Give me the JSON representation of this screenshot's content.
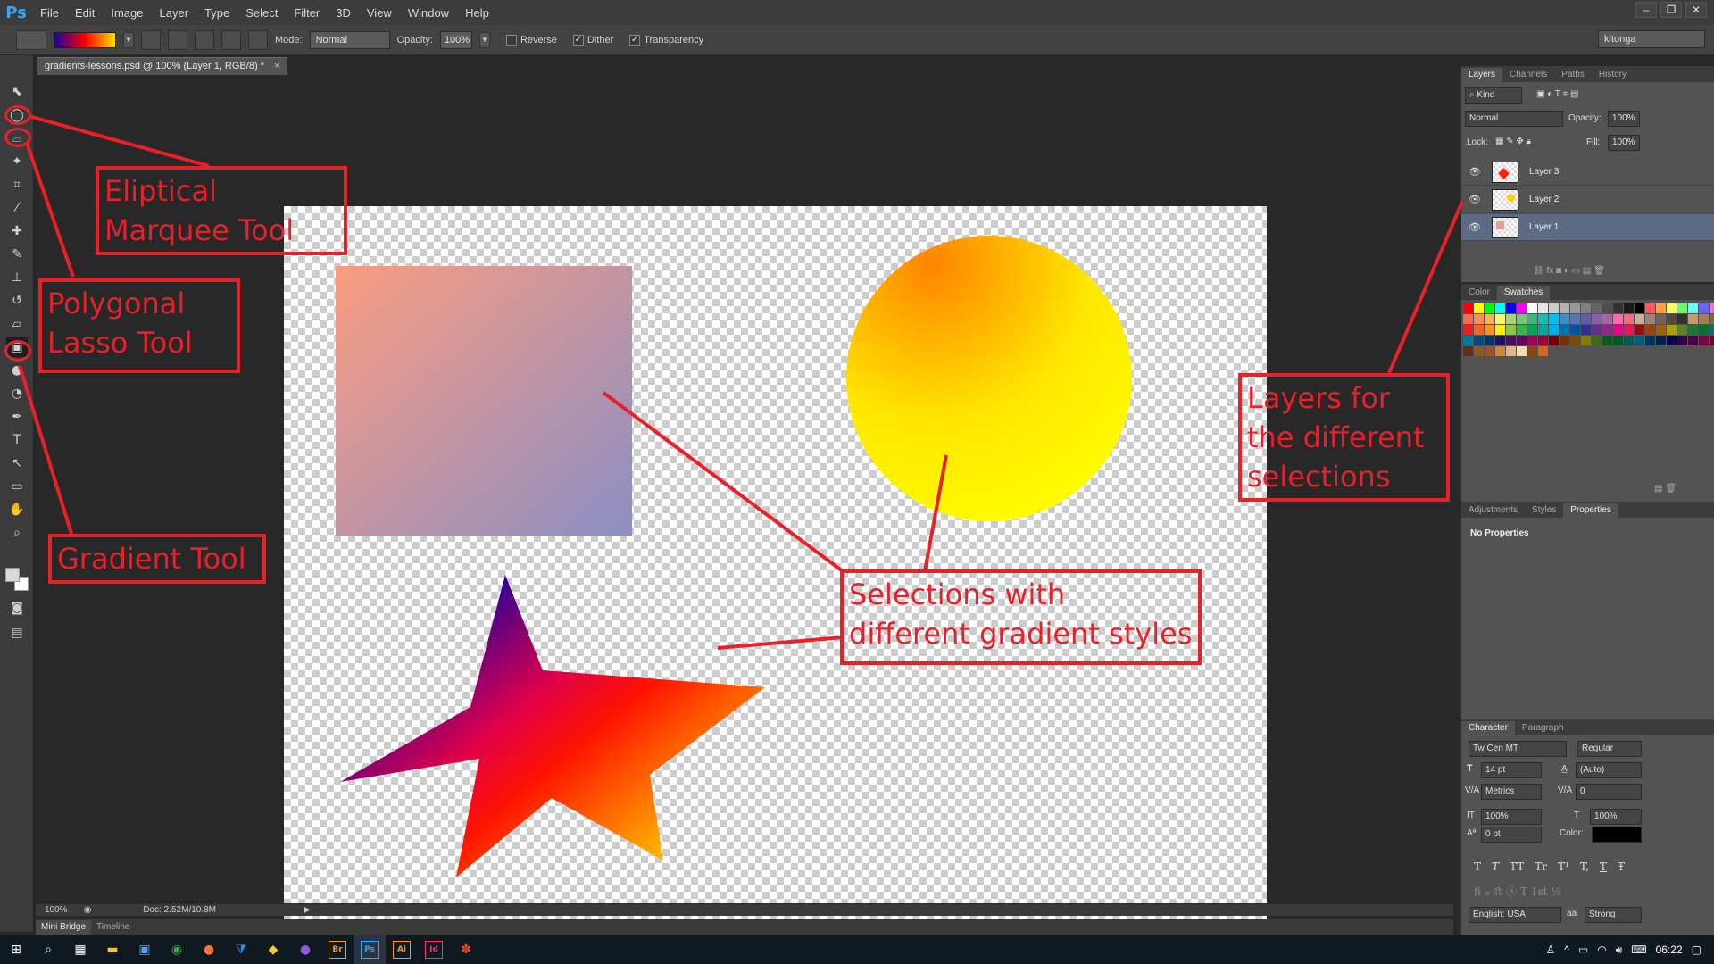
{
  "menubar": {
    "logo": "Ps",
    "items": [
      "File",
      "Edit",
      "Image",
      "Layer",
      "Type",
      "Select",
      "Filter",
      "3D",
      "View",
      "Window",
      "Help"
    ]
  },
  "options": {
    "mode_label": "Mode:",
    "mode_value": "Normal",
    "opacity_label": "Opacity:",
    "opacity_value": "100%",
    "reverse_label": "Reverse",
    "dither_label": "Dither",
    "transparency_label": "Transparency",
    "dither_checked": "✓",
    "transparency_checked": "✓",
    "workspace": "kitonga"
  },
  "document": {
    "tab_title": "gradients-lessons.psd @ 100% (Layer 1, RGB/8) *",
    "close": "×"
  },
  "statusbar": {
    "zoom": "100%",
    "doc": "Doc: 2.52M/10.8M"
  },
  "bottom_tabs": [
    "Mini Bridge",
    "Timeline"
  ],
  "layers_panel": {
    "tabs": [
      "Layers",
      "Channels",
      "Paths",
      "History"
    ],
    "kind": "Kind",
    "blend": "Normal",
    "opacity_label": "Opacity:",
    "opacity_value": "100%",
    "lock_label": "Lock:",
    "fill_label": "Fill:",
    "fill_value": "100%",
    "layers": [
      {
        "name": "Layer 3",
        "selected": false
      },
      {
        "name": "Layer 2",
        "selected": false
      },
      {
        "name": "Layer 1",
        "selected": true
      }
    ]
  },
  "swatches_panel": {
    "tabs": [
      "Color",
      "Swatches"
    ],
    "colors": [
      "#ff0000",
      "#ffff00",
      "#00ff00",
      "#00ffff",
      "#0000ff",
      "#ff00ff",
      "#ffffff",
      "#e6e6e6",
      "#cccccc",
      "#b3b3b3",
      "#999999",
      "#808080",
      "#666666",
      "#4d4d4d",
      "#333333",
      "#1a1a1a",
      "#000000",
      "#ff5a5a",
      "#ffa040",
      "#ffff66",
      "#66ff66",
      "#66ffff",
      "#6666ff",
      "#ff66ff",
      "#f26c4f",
      "#f68e56",
      "#fbaf5c",
      "#fff467",
      "#acd372",
      "#7cc576",
      "#3bb878",
      "#1abbb4",
      "#00bff3",
      "#438ccb",
      "#5574b9",
      "#605ca8",
      "#855fa8",
      "#a763a9",
      "#f06ea9",
      "#f26d7d",
      "#c7b299",
      "#998675",
      "#736357",
      "#534741",
      "#37302d",
      "#c69c6d",
      "#a67c52",
      "#8c6239",
      "#ed1c24",
      "#f26522",
      "#f7941d",
      "#fff200",
      "#8dc63f",
      "#39b54a",
      "#00a651",
      "#00a99d",
      "#00aeef",
      "#0072bc",
      "#0054a6",
      "#2e3192",
      "#662d91",
      "#92278f",
      "#ec008c",
      "#ed145b",
      "#9e0b0f",
      "#a0410d",
      "#a3620a",
      "#aba000",
      "#598527",
      "#197b30",
      "#007236",
      "#00746b",
      "#0076a3",
      "#004a80",
      "#003471",
      "#1b1464",
      "#440e62",
      "#630460",
      "#9e005d",
      "#9e0039",
      "#790000",
      "#7b2e00",
      "#7d4900",
      "#827b00",
      "#406618",
      "#005e20",
      "#005826",
      "#005952",
      "#005b7f",
      "#003663",
      "#002157",
      "#0d004c",
      "#32004b",
      "#4b0049",
      "#7b0046",
      "#7a0026",
      "#5c3317",
      "#8b5a2b",
      "#a0522d",
      "#cd853f",
      "#deb887",
      "#f5deb3",
      "#8b4513",
      "#d2691e"
    ]
  },
  "adjust_panel": {
    "tabs": [
      "Adjustments",
      "Styles",
      "Properties"
    ],
    "content": "No Properties"
  },
  "character_panel": {
    "tabs": [
      "Character",
      "Paragraph"
    ],
    "font": "Tw Cen MT",
    "style": "Regular",
    "size": "14 pt",
    "leading": "(Auto)",
    "kerning": "Metrics",
    "tracking": "0",
    "vscale": "100%",
    "hscale": "100%",
    "baseline": "0 pt",
    "color_label": "Color:",
    "type_buttons": [
      "T",
      "T",
      "TT",
      "Tr",
      "T¹",
      "T,",
      "T",
      "Ŧ"
    ],
    "lang": "English: USA",
    "aa_label": "aa",
    "aa": "Strong"
  },
  "annotations": {
    "marquee": "Eliptical Marquee Tool",
    "lasso": "Polygonal Lasso Tool",
    "gradient": "Gradient Tool",
    "selections": "Selections with different gradient styles",
    "layers": "Layers for the different selections"
  },
  "taskbar": {
    "time": "06:22",
    "apps": [
      "Br",
      "Ps",
      "Ai",
      "Id"
    ]
  },
  "colors": {
    "annotation": "#e8202a",
    "ps_blue": "#31a8ff"
  }
}
